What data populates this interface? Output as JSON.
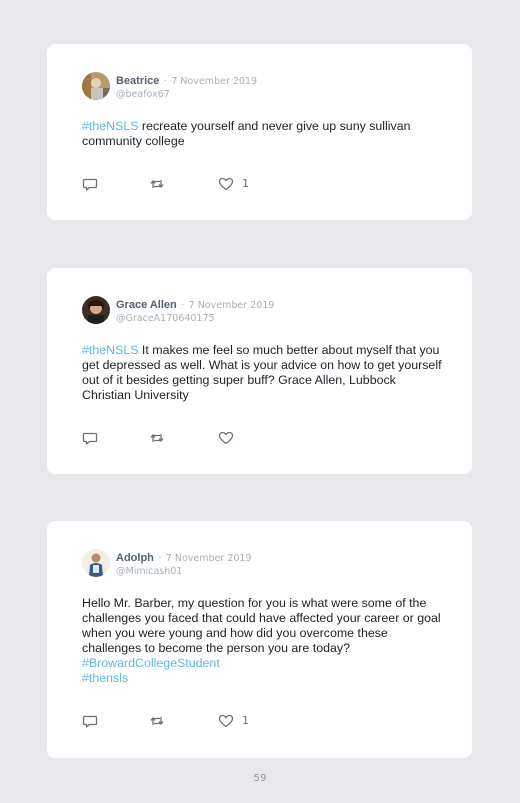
{
  "posts": [
    {
      "author": "Beatrice",
      "separator": "·",
      "date": "7 November 2019",
      "handle": "@beafox67",
      "body": [
        {
          "text": "#theNSLS",
          "hashtag": true
        },
        {
          "text": " recreate yourself and never give up suny sullivan community college",
          "hashtag": false
        }
      ],
      "like_count": "1"
    },
    {
      "author": "Grace Allen",
      "separator": "·",
      "date": "7 November 2019",
      "handle": "@GraceA170640175",
      "body": [
        {
          "text": "#theNSLS",
          "hashtag": true
        },
        {
          "text": " It makes me feel so much better about myself that you get depressed as well. What is your advice on how to get yourself out of it besides getting super buff? Grace Allen, Lubbock Christian University",
          "hashtag": false
        }
      ],
      "like_count": ""
    },
    {
      "author": "Adolph",
      "separator": "·",
      "date": "7 November 2019",
      "handle": "@Mimicash01",
      "body": [
        {
          "text": "Hello Mr. Barber, my question for you is what were some of the challenges you faced that could have affected your career or goal when you were young and how did you overcome these challenges to become the person you are today? ",
          "hashtag": false
        },
        {
          "text": "#BrowardCollegeStudent",
          "hashtag": true
        },
        {
          "text": "\n",
          "hashtag": false
        },
        {
          "text": "#thensls",
          "hashtag": true
        }
      ],
      "like_count": "1"
    }
  ],
  "page_number": "59",
  "colors": {
    "background": "#e7e7ec",
    "card": "#ffffff",
    "hashtag": "#5fb7e5",
    "author": "#536271",
    "meta": "#a8b0b8"
  },
  "icons": [
    "reply-icon",
    "retweet-icon",
    "like-icon"
  ]
}
